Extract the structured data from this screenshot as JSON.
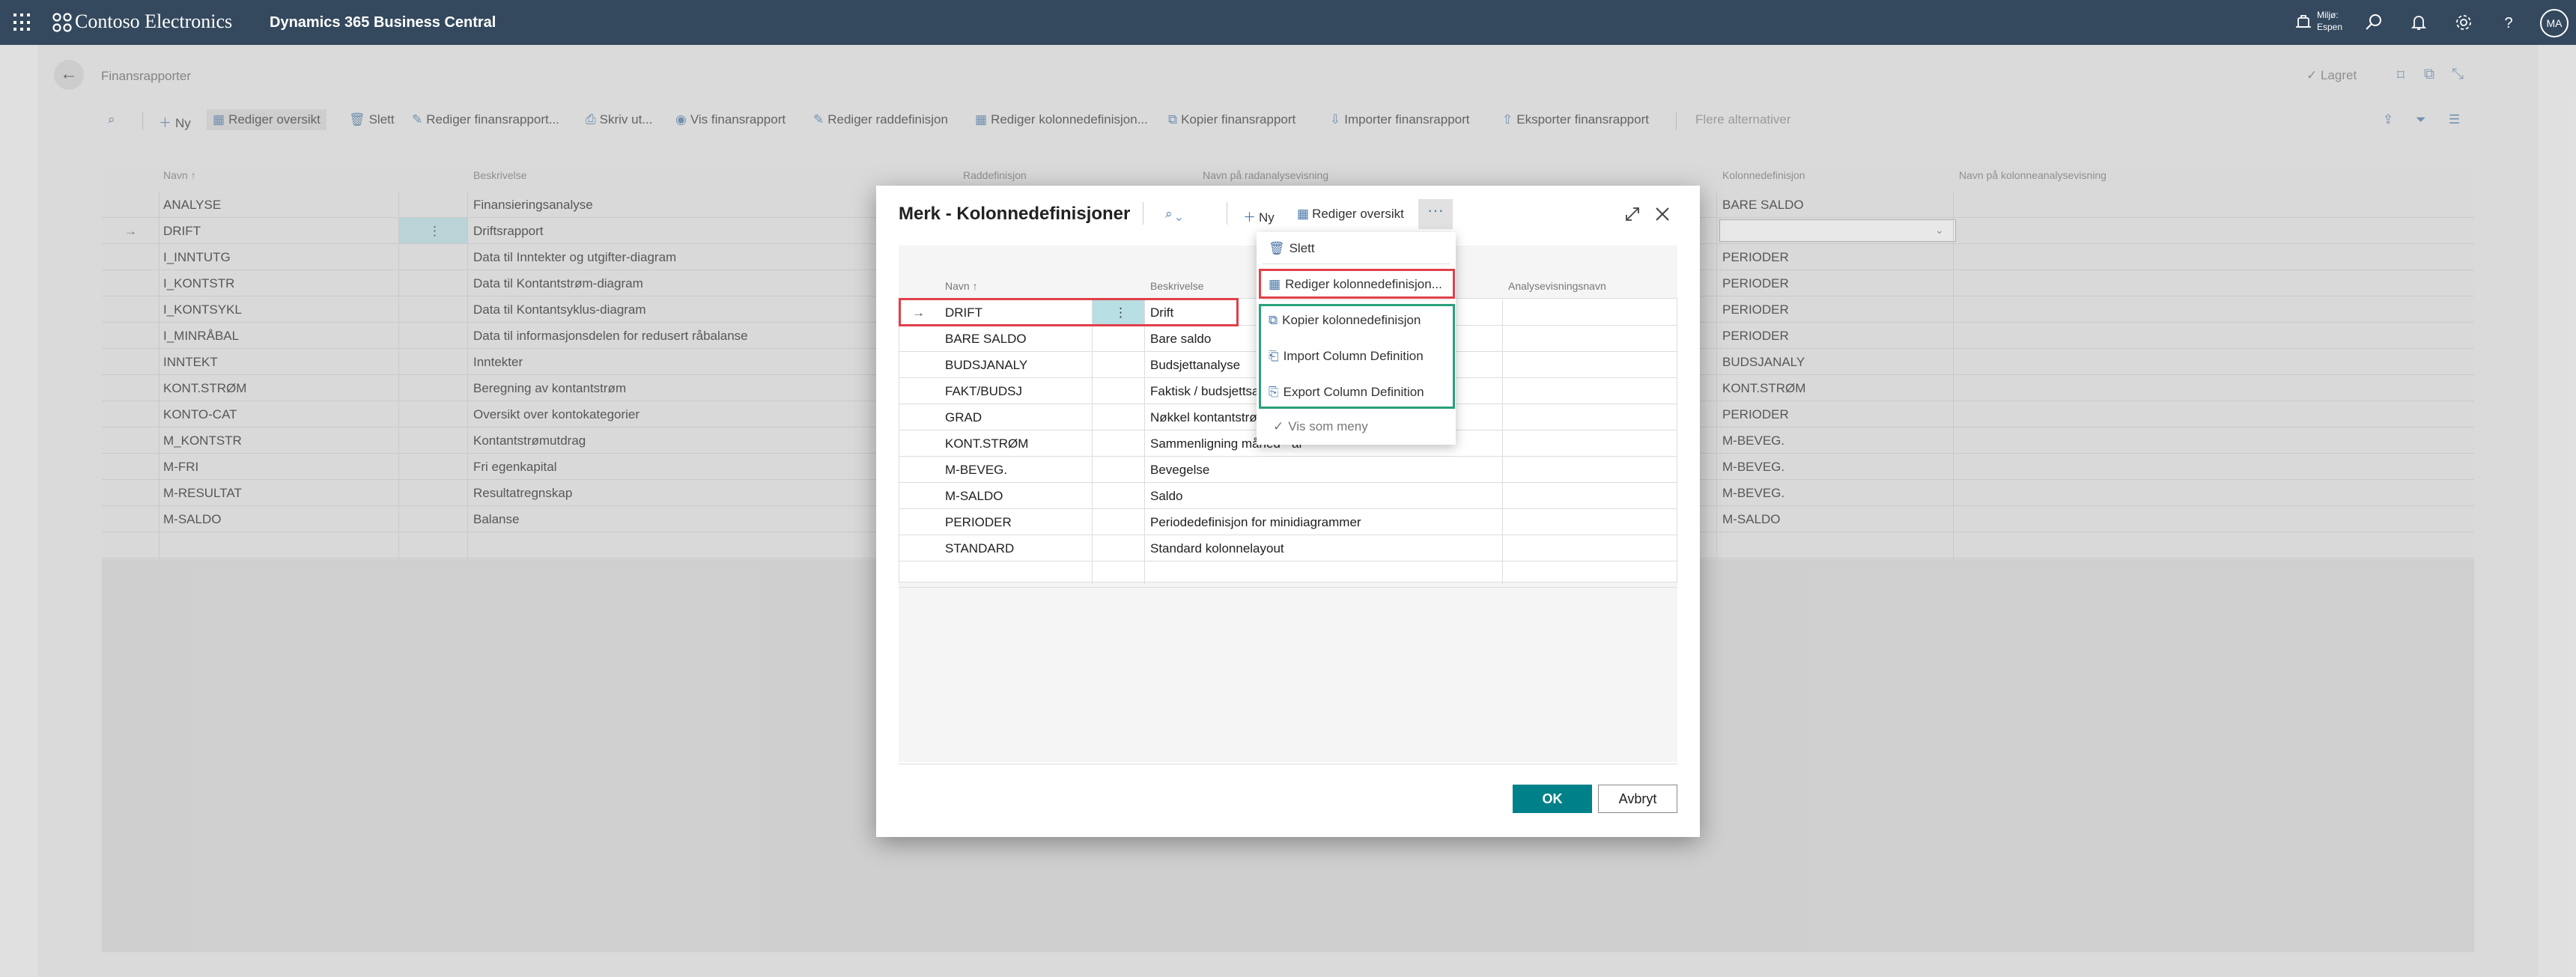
{
  "topbar": {
    "company": "Contoso Electronics",
    "product": "Dynamics 365 Business Central",
    "env_line1": "Miljø:",
    "env_line2": "Espen",
    "avatar": "MA"
  },
  "page": {
    "title": "Finansrapporter",
    "saved": "✓ Lagret"
  },
  "actions": {
    "new": "Ny",
    "edit_list": "Rediger oversikt",
    "delete": "Slett",
    "edit_report": "Rediger finansrapport...",
    "print": "Skriv ut...",
    "view_report": "Vis finansrapport",
    "edit_rowdef": "Rediger raddefinisjon",
    "edit_coldef": "Rediger kolonnedefinisjon...",
    "copy_report": "Kopier finansrapport",
    "import_report": "Importer finansrapport",
    "export_report": "Eksporter finansrapport",
    "more_options": "Flere alternativer"
  },
  "grid": {
    "headers": {
      "name": "Navn ↑",
      "description": "Beskrivelse",
      "rowdef": "Raddefinisjon",
      "rowview": "Navn på radanalysevisning",
      "coldef": "Kolonnedefinisjon",
      "colview": "Navn på kolonneanalysevisning"
    },
    "rows": [
      {
        "name": "ANALYSE",
        "description": "Finansieringsanalyse",
        "coldef": "BARE SALDO"
      },
      {
        "name": "DRIFT",
        "description": "Driftsrapport",
        "coldef": ""
      },
      {
        "name": "I_INNTUTG",
        "description": "Data til Inntekter og utgifter-diagram",
        "coldef": "PERIODER"
      },
      {
        "name": "I_KONTSTR",
        "description": "Data til Kontantstrøm-diagram",
        "coldef": "PERIODER"
      },
      {
        "name": "I_KONTSYKL",
        "description": "Data til Kontantsyklus-diagram",
        "coldef": "PERIODER"
      },
      {
        "name": "I_MINRÅBAL",
        "description": "Data til informasjonsdelen for redusert råbalanse",
        "coldef": "PERIODER"
      },
      {
        "name": "INNTEKT",
        "description": "Inntekter",
        "coldef": "BUDSJANALY"
      },
      {
        "name": "KONT.STRØM",
        "description": "Beregning av kontantstrøm",
        "coldef": "KONT.STRØM"
      },
      {
        "name": "KONTO-CAT",
        "description": "Oversikt over kontokategorier",
        "coldef": "PERIODER"
      },
      {
        "name": "M_KONTSTR",
        "description": "Kontantstrømutdrag",
        "coldef": "M-BEVEG."
      },
      {
        "name": "M-FRI",
        "description": "Fri egenkapital",
        "coldef": "M-BEVEG."
      },
      {
        "name": "M-RESULTAT",
        "description": "Resultatregnskap",
        "coldef": "M-BEVEG."
      },
      {
        "name": "M-SALDO",
        "description": "Balanse",
        "coldef": "M-SALDO"
      }
    ]
  },
  "dialog": {
    "title": "Merk - Kolonnedefinisjoner",
    "new": "Ny",
    "edit_list": "Rediger oversikt",
    "headers": {
      "name": "Navn ↑",
      "description": "Beskrivelse",
      "viewname": "Analysevisningsnavn"
    },
    "rows": [
      {
        "name": "DRIFT",
        "description": "Drift"
      },
      {
        "name": "BARE SALDO",
        "description": "Bare saldo"
      },
      {
        "name": "BUDSJANALY",
        "description": "Budsjettanalyse"
      },
      {
        "name": "FAKT/BUDSJ",
        "description": "Faktisk / budsjettsa"
      },
      {
        "name": "GRAD",
        "description": "Nøkkel kontantstrø"
      },
      {
        "name": "KONT.STRØM",
        "description": "Sammenligning måned - år"
      },
      {
        "name": "M-BEVEG.",
        "description": "Bevegelse"
      },
      {
        "name": "M-SALDO",
        "description": "Saldo"
      },
      {
        "name": "PERIODER",
        "description": "Periodedefinisjon for minidiagrammer"
      },
      {
        "name": "STANDARD",
        "description": "Standard kolonnelayout"
      }
    ],
    "ok": "OK",
    "cancel": "Avbryt"
  },
  "menu": {
    "delete": "Slett",
    "edit_coldef": "Rediger kolonnedefinisjon...",
    "copy_coldef": "Kopier kolonnedefinisjon",
    "import": "Import Column Definition",
    "export": "Export Column Definition",
    "show_as_menu": "Vis som meny"
  },
  "colors": {
    "topbar": "#34495e",
    "accent": "#00818a",
    "highlight_red": "#e0404a",
    "highlight_teal": "#2aa07a"
  }
}
